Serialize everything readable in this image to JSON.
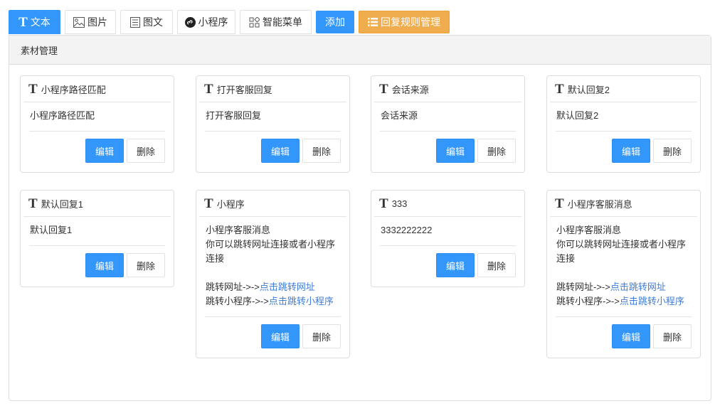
{
  "tabs": [
    {
      "label": "文本",
      "icon": "text-t-icon",
      "active": true
    },
    {
      "label": "图片",
      "icon": "image-icon",
      "active": false
    },
    {
      "label": "图文",
      "icon": "article-icon",
      "active": false
    },
    {
      "label": "小程序",
      "icon": "miniprogram-icon",
      "active": false
    },
    {
      "label": "智能菜单",
      "icon": "grid-menu-icon",
      "active": false
    }
  ],
  "toolbar": {
    "add_label": "添加",
    "rules_label": "回复规则管理"
  },
  "panel": {
    "title": "素材管理"
  },
  "card_actions": {
    "edit_label": "编辑",
    "delete_label": "删除"
  },
  "cards": [
    {
      "title": "小程序路径匹配",
      "lines": [
        {
          "text": "小程序路径匹配"
        }
      ]
    },
    {
      "title": "打开客服回复",
      "lines": [
        {
          "text": "打开客服回复"
        }
      ]
    },
    {
      "title": "会话来源",
      "lines": [
        {
          "text": "会话来源"
        }
      ]
    },
    {
      "title": "默认回复2",
      "lines": [
        {
          "text": "默认回复2"
        }
      ]
    },
    {
      "title": "默认回复1",
      "lines": [
        {
          "text": "默认回复1"
        }
      ]
    },
    {
      "title": "小程序",
      "lines": [
        {
          "text": "小程序客服消息"
        },
        {
          "text": "你可以跳转网址连接或者小程序连接"
        },
        {
          "text": ""
        },
        {
          "text": "跳转网址->->",
          "link": "点击跳转网址"
        },
        {
          "text": "跳转小程序->->",
          "link": "点击跳转小程序"
        }
      ]
    },
    {
      "title": "333",
      "lines": [
        {
          "text": "3332222222"
        }
      ]
    },
    {
      "title": "小程序客服消息",
      "lines": [
        {
          "text": "小程序客服消息"
        },
        {
          "text": "你可以跳转网址连接或者小程序连接"
        },
        {
          "text": ""
        },
        {
          "text": "跳转网址->->",
          "link": "点击跳转网址"
        },
        {
          "text": "跳转小程序->->",
          "link": "点击跳转小程序"
        }
      ]
    }
  ]
}
